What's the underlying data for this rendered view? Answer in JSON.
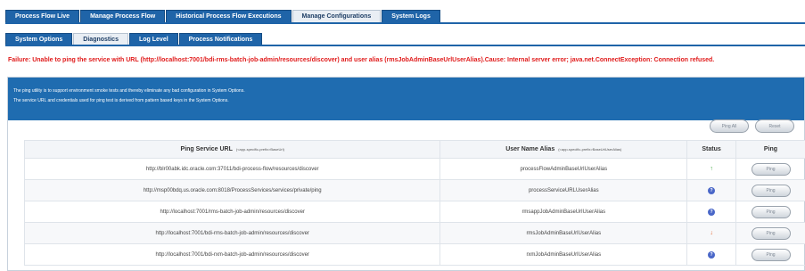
{
  "top_tabs": [
    {
      "label": "Process Flow Live"
    },
    {
      "label": "Manage Process Flow"
    },
    {
      "label": "Historical Process Flow Executions"
    },
    {
      "label": "Manage Configurations"
    },
    {
      "label": "System Logs"
    }
  ],
  "sub_tabs": [
    {
      "label": "System Options"
    },
    {
      "label": "Diagnostics"
    },
    {
      "label": "Log Level"
    },
    {
      "label": "Process Notifications"
    }
  ],
  "active_top_tab": "Manage Configurations",
  "active_sub_tab": "Diagnostics",
  "error_message": "Failure: Unable to ping the service with URL (http://localhost:7001/bdi-rms-batch-job-admin/resources/discover) and user alias (rmsJobAdminBaseUrlUserAlias).Cause: Internal server error; java.net.ConnectException: Connection refused.",
  "info": {
    "line1": "The ping utility is to support environment smoke tests and thereby eliminate any bad configuration in System Options.",
    "line2": "The service URL and credentials used for ping test is derived from pattern based keys in the System Options."
  },
  "buttons": {
    "ping_all": "Ping All",
    "reset": "Reset"
  },
  "table": {
    "headers": {
      "url": "Ping Service URL",
      "url_hint": "(<app-specific-prefix>BaseUrl)",
      "alias": "User Name Alias",
      "alias_hint": "(<app-specific-prefix>BaseUrlUserAlias)",
      "status": "Status",
      "ping": "Ping"
    },
    "rows": [
      {
        "url": "http://blr00abk.idc.oracle.com:37011/bdi-process-flow/resources/discover",
        "alias": "processFlowAdminBaseUrlUserAlias",
        "status": "up",
        "status_icon": "↑",
        "ping_label": "Ping"
      },
      {
        "url": "http://msp00bdq.us.oracle.com:8018/ProcessServices/services/private/ping",
        "alias": "processServiceURLUserAlias",
        "status": "unknown",
        "status_icon": "?",
        "ping_label": "Ping"
      },
      {
        "url": "http://localhost:7001/rms-batch-job-admin/resources/discover",
        "alias": "rmsappJobAdminBaseUrlUserAlias",
        "status": "unknown",
        "status_icon": "?",
        "ping_label": "Ping"
      },
      {
        "url": "http://localhost:7001/bdi-rms-batch-job-admin/resources/discover",
        "alias": "rmsJobAdminBaseUrlUserAlias",
        "status": "down",
        "status_icon": "↓",
        "ping_label": "Ping"
      },
      {
        "url": "http://localhost:7001/bdi-rxm-batch-job-admin/resources/discover",
        "alias": "rxmJobAdminBaseUrlUserAlias",
        "status": "unknown",
        "status_icon": "?",
        "ping_label": "Ping"
      }
    ]
  },
  "colors": {
    "tab_blue": "#1f64a8",
    "banner_blue": "#1f6cb0",
    "error_red": "#e01b1b",
    "status_up": "#3aa53a",
    "status_down": "#e4632a",
    "status_unknown": "#4a67c8"
  }
}
